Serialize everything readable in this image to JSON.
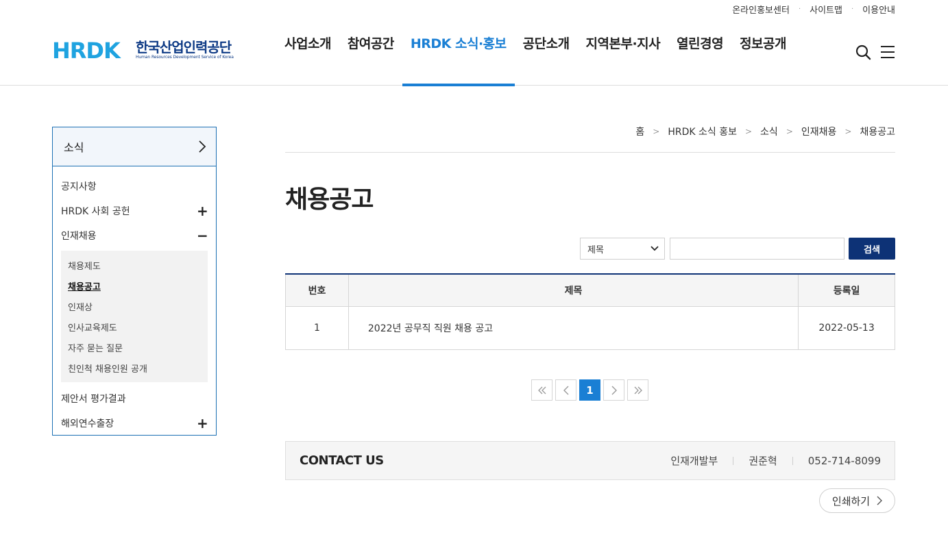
{
  "utility_links": [
    "온라인홍보센터",
    "사이트맵",
    "이용안내"
  ],
  "logo": {
    "mark_text": "HRDK",
    "name_ko": "한국산업인력공단",
    "name_en": "Human Resources Development Service of Korea"
  },
  "gnb": {
    "items": [
      "사업소개",
      "참여공간",
      "HRDK 소식·홍보",
      "공단소개",
      "지역본부·지사",
      "열린경영",
      "정보공개"
    ],
    "active_index": 2
  },
  "header_icons": [
    "search-icon",
    "menu-icon"
  ],
  "lnb": {
    "title": "소식",
    "items": [
      {
        "label": "공지사항",
        "toggle": ""
      },
      {
        "label": "HRDK 사회 공헌",
        "toggle": "+"
      },
      {
        "label": "인재채용",
        "toggle": "−"
      }
    ],
    "sub_items": [
      "채용제도",
      "채용공고",
      "인재상",
      "인사교육제도",
      "자주 묻는 질문",
      "친인척 채용인원 공개"
    ],
    "sub_active_index": 1,
    "items_after": [
      {
        "label": "제안서 평가결과",
        "toggle": ""
      },
      {
        "label": "해외연수출장",
        "toggle": "+"
      }
    ]
  },
  "breadcrumb": [
    "홈",
    "HRDK 소식 홍보",
    "소식",
    "인재채용",
    "채용공고"
  ],
  "page_title": "채용공고",
  "search": {
    "select_value": "제목",
    "input_value": "",
    "button_label": "검색"
  },
  "table": {
    "headers": [
      "번호",
      "제목",
      "등록일"
    ],
    "rows": [
      {
        "no": "1",
        "title": "2022년 공무직 직원 채용 공고",
        "date": "2022-05-13"
      }
    ]
  },
  "pagination": {
    "first": "«",
    "prev": "‹",
    "current": "1",
    "next": "›",
    "last": "»"
  },
  "contact": {
    "label": "CONTACT US",
    "department": "인재개발부",
    "person": "권준혁",
    "phone": "052-714-8099"
  },
  "print_label": "인쇄하기",
  "colors": {
    "accent": "#1a7fd4",
    "navy": "#0d3276",
    "lnb_border": "#1a6fb3"
  }
}
